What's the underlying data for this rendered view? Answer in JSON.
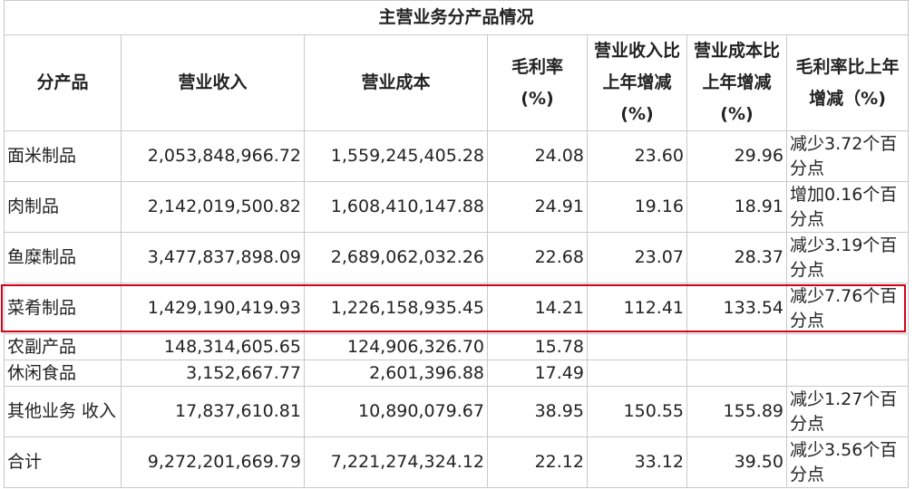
{
  "title": "主营业务分产品情况",
  "headers": {
    "product": "分产品",
    "revenue": "营业收入",
    "cost": "营业成本",
    "gross_margin": "毛利率 (%)",
    "revenue_change": "营业收入比上年增减 (%)",
    "cost_change": "营业成本比上年增减 (%)",
    "margin_change": "毛利率比上年增减 (%)"
  },
  "header_lines": {
    "gross_margin": [
      "毛利率",
      "(%)"
    ],
    "revenue_change": [
      "营业收入比",
      "上年增减",
      "(%)"
    ],
    "cost_change": [
      "营业成本比",
      "上年增减",
      "(%)"
    ],
    "margin_change": [
      "毛利率比上年",
      "增减（%)"
    ]
  },
  "rows": [
    {
      "product": "面米制品",
      "revenue": "2,053,848,966.72",
      "cost": "1,559,245,405.28",
      "gross_margin": "24.08",
      "revenue_change": "23.60",
      "cost_change": "29.96",
      "margin_change": "减少3.72个百分点"
    },
    {
      "product": "肉制品",
      "revenue": "2,142,019,500.82",
      "cost": "1,608,410,147.88",
      "gross_margin": "24.91",
      "revenue_change": "19.16",
      "cost_change": "18.91",
      "margin_change": "增加0.16个百分点"
    },
    {
      "product": "鱼糜制品",
      "revenue": "3,477,837,898.09",
      "cost": "2,689,062,032.26",
      "gross_margin": "22.68",
      "revenue_change": "23.07",
      "cost_change": "28.37",
      "margin_change": "减少3.19个百分点"
    },
    {
      "product": "菜肴制品",
      "revenue": "1,429,190,419.93",
      "cost": "1,226,158,935.45",
      "gross_margin": "14.21",
      "revenue_change": "112.41",
      "cost_change": "133.54",
      "margin_change": "减少7.76个百分点",
      "highlighted": true
    },
    {
      "product": "农副产品",
      "revenue": "148,314,605.65",
      "cost": "124,906,326.70",
      "gross_margin": "15.78",
      "revenue_change": "",
      "cost_change": "",
      "margin_change": ""
    },
    {
      "product": "休闲食品",
      "revenue": "3,152,667.77",
      "cost": "2,601,396.88",
      "gross_margin": "17.49",
      "revenue_change": "",
      "cost_change": "",
      "margin_change": ""
    },
    {
      "product": "其他业务 收入",
      "revenue": "17,837,610.81",
      "cost": "10,890,079.67",
      "gross_margin": "38.95",
      "revenue_change": "150.55",
      "cost_change": "155.89",
      "margin_change": "减少1.27个百分点"
    },
    {
      "product": "合计",
      "revenue": "9,272,201,669.79",
      "cost": "7,221,274,324.12",
      "gross_margin": "22.12",
      "revenue_change": "33.12",
      "cost_change": "39.50",
      "margin_change": "减少3.56个百分点"
    }
  ],
  "highlight_color": "#d0021b"
}
